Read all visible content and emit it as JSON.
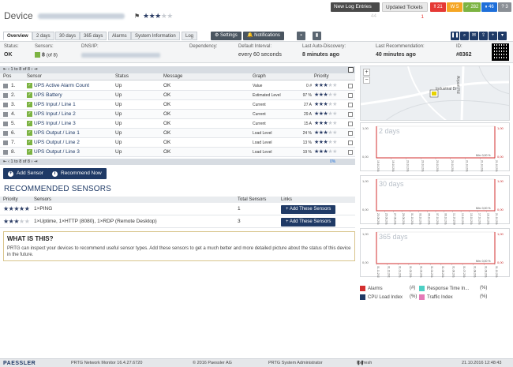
{
  "header": {
    "title": "Device",
    "new_log_label": "New Log Entries",
    "new_log_count": "44",
    "updated_label": "Updated Tickets",
    "updated_count": "1",
    "status_counts": [
      {
        "name": "red",
        "value": "21",
        "color": "#e53935"
      },
      {
        "name": "yellow",
        "value": "5",
        "color": "#f5a623"
      },
      {
        "name": "green",
        "value": "282",
        "color": "#7cb342"
      },
      {
        "name": "blue",
        "value": "46",
        "color": "#1e6fd9"
      },
      {
        "name": "gray",
        "value": "3",
        "color": "#8a8f96"
      }
    ]
  },
  "tabs": [
    "Overview",
    "2 days",
    "30 days",
    "365 days",
    "Alarms",
    "System Information",
    "Log"
  ],
  "buttons": {
    "settings": "Settings",
    "notifications": "Notifications"
  },
  "info": {
    "status_label": "Status:",
    "status_value": "OK",
    "sensors_label": "Sensors:",
    "sensors_value": "8",
    "sensors_of": "(of 8)",
    "dns_label": "DNS/IP:",
    "dependency_label": "Dependency:",
    "interval_label": "Default Interval:",
    "interval_value": "every 60 seconds",
    "discovery_label": "Last Auto-Discovery:",
    "discovery_value": "8 minutes ago",
    "recommend_label": "Last Recommendation:",
    "recommend_value": "40 minutes ago",
    "id_label": "ID:",
    "id_value": "#8362"
  },
  "table": {
    "pager_top": "1 to 8 of 8",
    "pager_bottom": "1 to 8 of 8",
    "columns": [
      "Pos",
      "Sensor",
      "Status",
      "Message",
      "Graph",
      "Priority"
    ],
    "rows": [
      {
        "pos": "1.",
        "sensor": "UPS Active Alarm Count",
        "status": "Up",
        "message": "OK",
        "graph": "Value",
        "val": "0 #"
      },
      {
        "pos": "2.",
        "sensor": "UPS Battery",
        "status": "Up",
        "message": "OK",
        "graph": "Estimated Level",
        "val": "97 %"
      },
      {
        "pos": "3.",
        "sensor": "UPS Input / Line 1",
        "status": "Up",
        "message": "OK",
        "graph": "Current",
        "val": "27 A"
      },
      {
        "pos": "4.",
        "sensor": "UPS Input / Line 2",
        "status": "Up",
        "message": "OK",
        "graph": "Current",
        "val": "29 A"
      },
      {
        "pos": "5.",
        "sensor": "UPS Input / Line 3",
        "status": "Up",
        "message": "OK",
        "graph": "Current",
        "val": "15 A"
      },
      {
        "pos": "6.",
        "sensor": "UPS Output / Line 1",
        "status": "Up",
        "message": "OK",
        "graph": "Load Level",
        "val": "24 %"
      },
      {
        "pos": "7.",
        "sensor": "UPS Output / Line 2",
        "status": "Up",
        "message": "OK",
        "graph": "Load Level",
        "val": "13 %"
      },
      {
        "pos": "8.",
        "sensor": "UPS Output / Line 3",
        "status": "Up",
        "message": "OK",
        "graph": "Load Level",
        "val": "19 %"
      }
    ],
    "footer_pct": "0%"
  },
  "actions": {
    "add_sensor": "Add Sensor",
    "recommend_now": "Recommend Now"
  },
  "recommended": {
    "title": "RECOMMENDED SENSORS",
    "columns": [
      "Priority",
      "Sensors",
      "Total Sensors",
      "Links"
    ],
    "rows": [
      {
        "sensors": "1×PING",
        "total": "1",
        "link": "Add These Sensors"
      },
      {
        "sensors": "1×Uptime, 1×HTTP (8080), 1×RDP (Remote Desktop)",
        "total": "3",
        "link": "Add These Sensors"
      }
    ]
  },
  "what": {
    "title": "WHAT IS THIS?",
    "text": "PRTG can inspect your devices to recommend useful sensor types. Add these sensors to get a much better and more detailed picture about the status of this device in the future."
  },
  "map": {
    "street1": "Industrial Dr",
    "street2": "Airport Rd"
  },
  "charts": [
    {
      "title": "2 days",
      "ymax": "1,00",
      "ymin": "0,00",
      "note": "Min: 0,00 %",
      "ticks": [
        "19.10.2016 12:00",
        "19.10.2016 18:00",
        "20.10.2016 00:00",
        "20.10.2016 06:00",
        "20.10.2016 12:00",
        "20.10.2016 18:00",
        "21.10.2016 00:00",
        "21.10.2016 06:00",
        "21.10.2016 12:00"
      ]
    },
    {
      "title": "30 days",
      "ymax": "1,00",
      "ymin": "0,00",
      "note": "Min: 0,00 %",
      "ticks": [
        "23.09.2016",
        "25.09.2016",
        "27.09.2016",
        "29.09.2016",
        "01.10.2016",
        "03.10.2016",
        "05.10.2016",
        "07.10.2016",
        "09.10.2016",
        "11.10.2016",
        "13.10.2016",
        "15.10.2016",
        "17.10.2016",
        "19.10.2016",
        "21.10.2016"
      ]
    },
    {
      "title": "365 days",
      "ymax": "1,00",
      "ymin": "0,00",
      "note": "Min: 0,00 %",
      "ticks": [
        "01.11.2015",
        "01.12.2015",
        "01.01.2016",
        "01.02.2016",
        "01.03.2016",
        "01.04.2016",
        "01.05.2016",
        "01.06.2016",
        "01.07.2016",
        "01.08.2016",
        "01.09.2016",
        "01.10.2016"
      ]
    }
  ],
  "legend": [
    {
      "label": "Alarms",
      "unit": "(#)",
      "color": "#d32f2f"
    },
    {
      "label": "Response Time In...",
      "unit": "(%)",
      "color": "#4dd0c4"
    },
    {
      "label": "CPU Load Index",
      "unit": "(%)",
      "color": "#1f3a66"
    },
    {
      "label": "Traffic Index",
      "unit": "(%)",
      "color": "#e57ab8"
    }
  ],
  "footer": {
    "brand": "PAESSLER",
    "version": "PRTG Network Monitor 16.4.27.6720",
    "copyright": "© 2016 Paessler AG",
    "user": "PRTG System Administrator",
    "refresh": "Refresh in 24 sec",
    "datetime": "21.10.2016 12:48:43"
  }
}
